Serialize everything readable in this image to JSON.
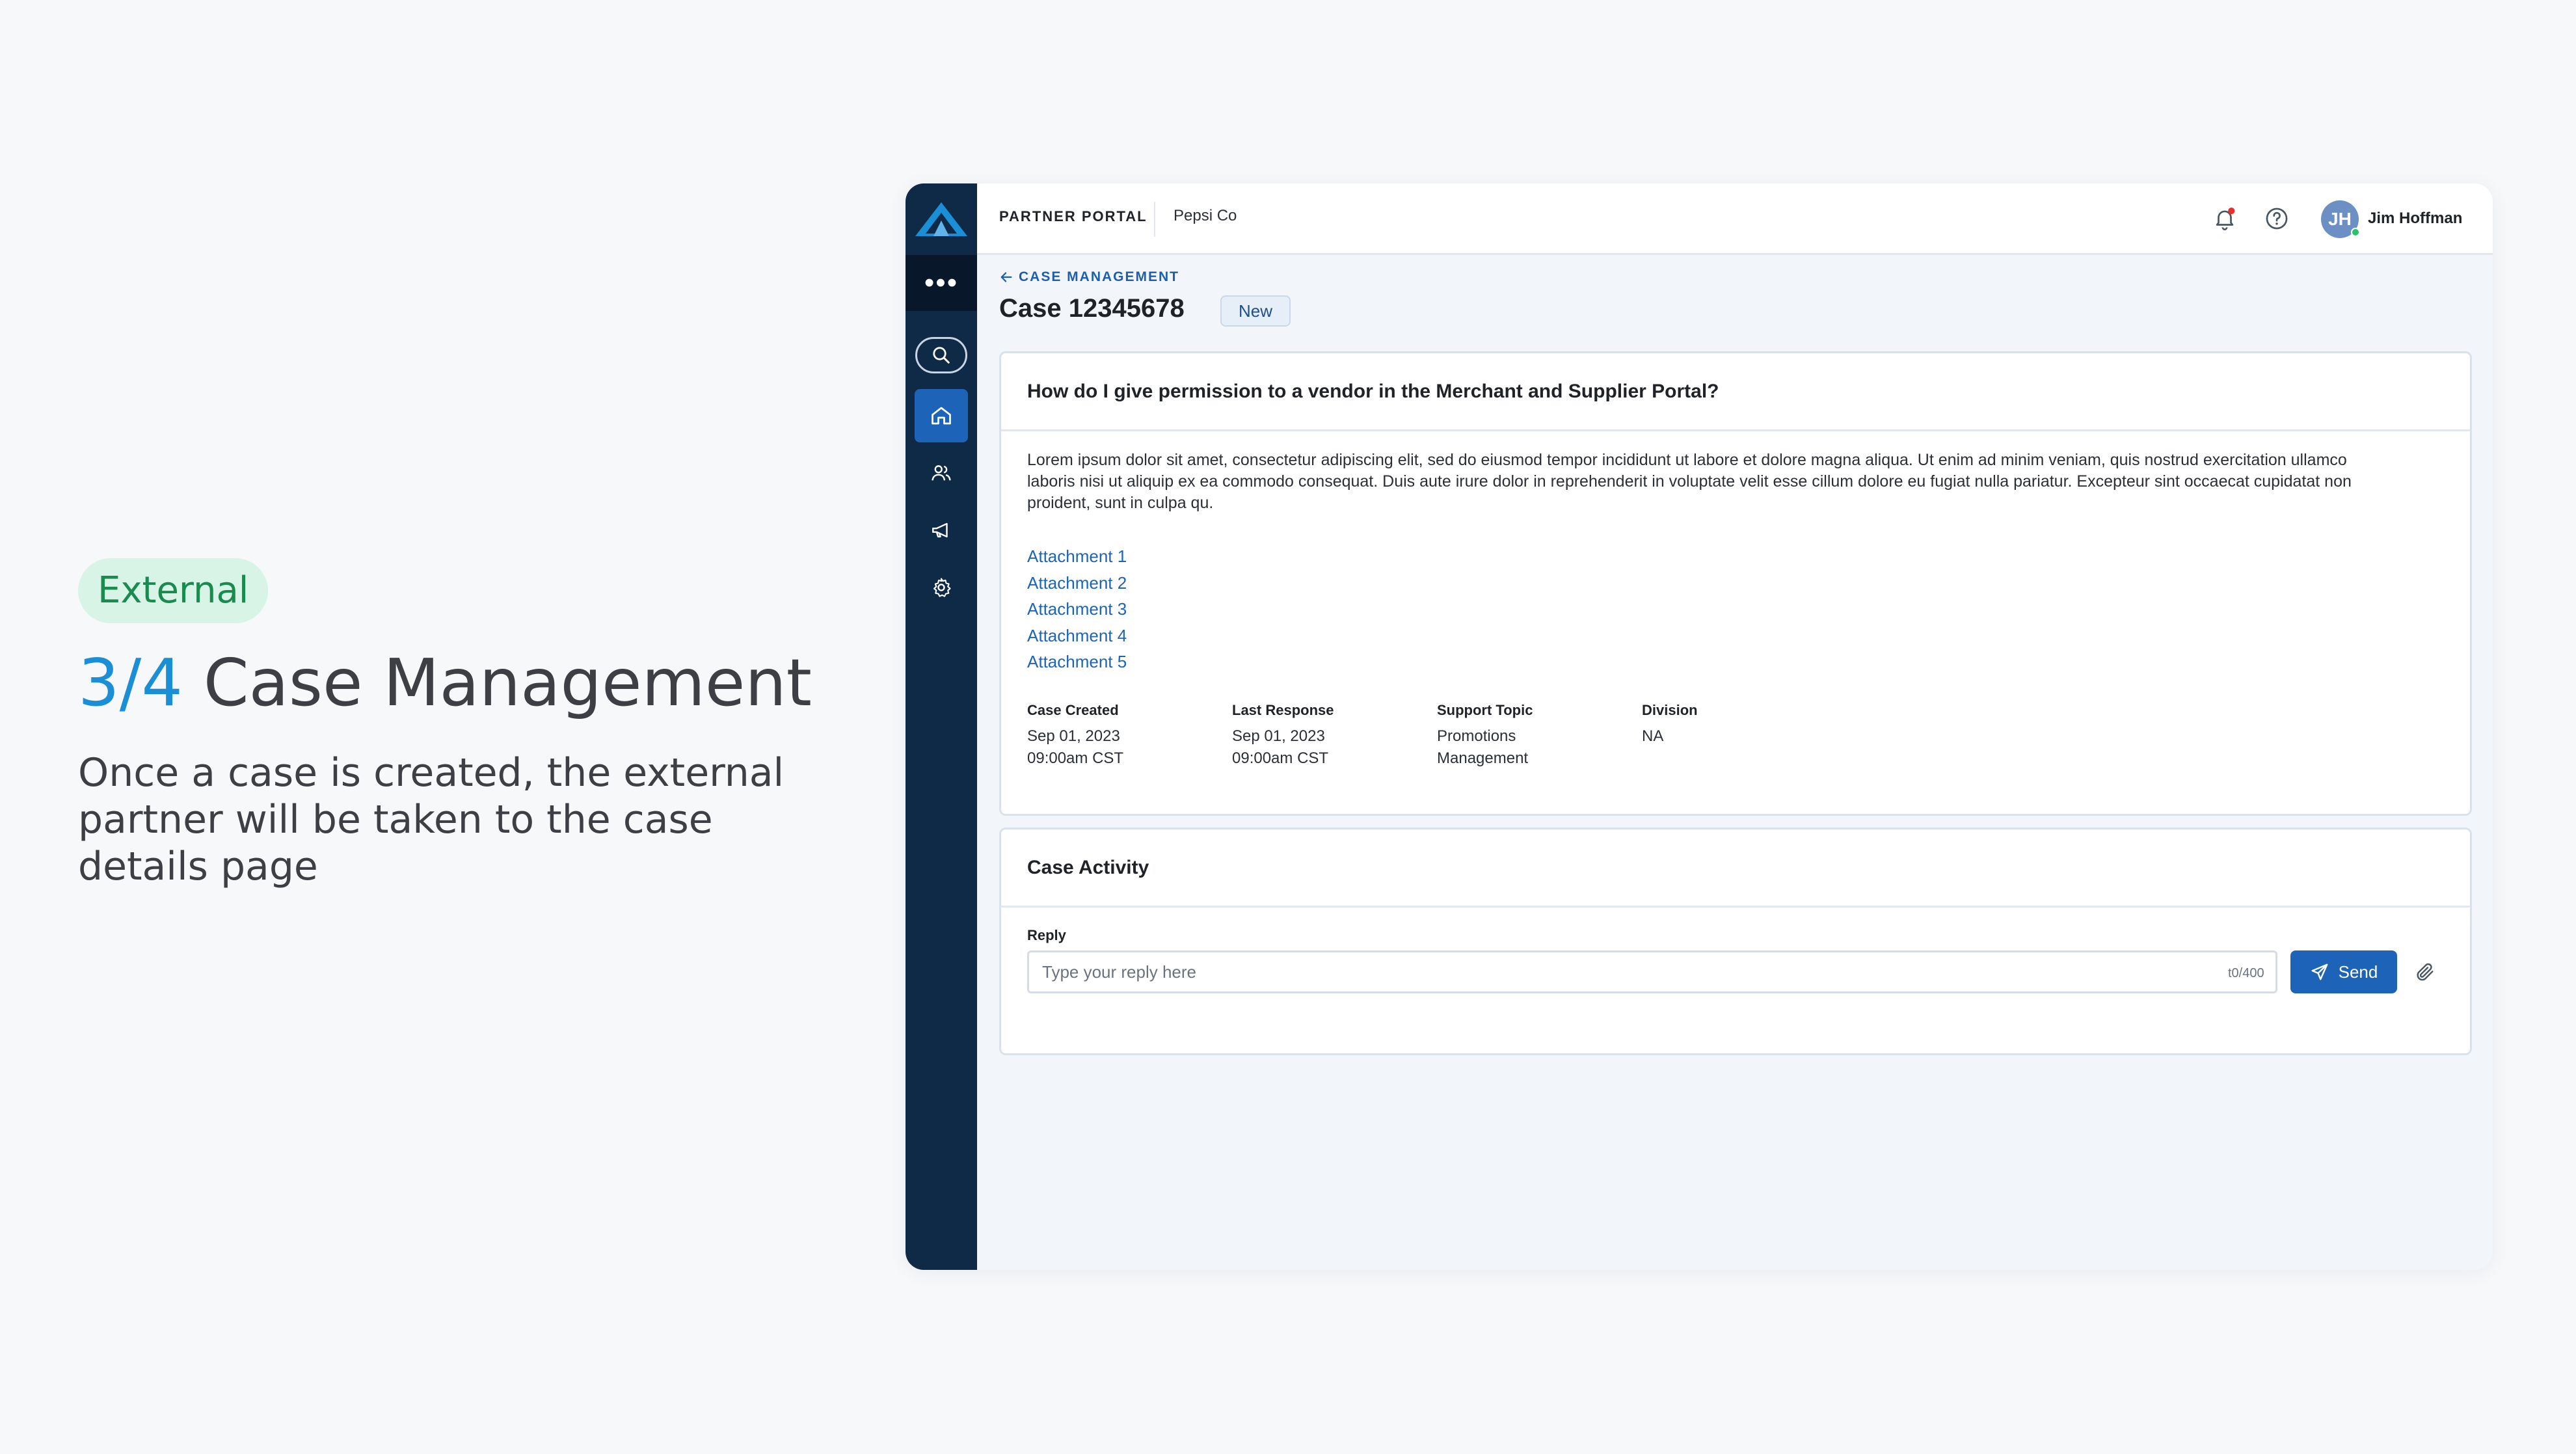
{
  "slide": {
    "badge": "External",
    "step": "3/4",
    "title": "Case Management",
    "description": "Once a case is created, the external partner will be taken to the case details page"
  },
  "header": {
    "portal_label": "PARTNER PORTAL",
    "org_name": "Pepsi Co",
    "user_initials": "JH",
    "user_name": "Jim Hoffman",
    "icons": [
      "bell-icon",
      "help-icon"
    ]
  },
  "sidebar": {
    "more_label": "•••",
    "items": [
      "search-icon",
      "home-icon",
      "users-icon",
      "megaphone-icon",
      "gear-icon"
    ],
    "active_item": "home-icon"
  },
  "case": {
    "breadcrumb": "CASE MANAGEMENT",
    "title": "Case 12345678",
    "status": "New",
    "question": "How do I give permission to a vendor in the Merchant and Supplier Portal?",
    "description": "Lorem ipsum dolor sit amet, consectetur adipiscing elit, sed do eiusmod tempor incididunt ut labore et dolore magna aliqua. Ut enim ad minim veniam, quis nostrud exercitation ullamco laboris nisi ut aliquip ex ea commodo consequat. Duis aute irure dolor in reprehenderit in voluptate velit esse cillum dolore eu fugiat nulla pariatur. Excepteur sint occaecat cupidatat non proident, sunt in culpa qu.",
    "attachments": [
      "Attachment 1",
      "Attachment 2",
      "Attachment 3",
      "Attachment 4",
      "Attachment 5"
    ],
    "meta": [
      {
        "label": "Case Created",
        "line1": "Sep 01, 2023",
        "line2": "09:00am CST"
      },
      {
        "label": "Last Response",
        "line1": "Sep 01, 2023",
        "line2": "09:00am CST"
      },
      {
        "label": "Support Topic",
        "line1": "Promotions",
        "line2": "Management"
      },
      {
        "label": "Division",
        "line1": "NA",
        "line2": ""
      }
    ]
  },
  "activity": {
    "title": "Case Activity",
    "reply_label": "Reply",
    "reply_value": "",
    "reply_placeholder": "Type your reply here",
    "counter": "t0/400",
    "send_label": "Send"
  },
  "colors": {
    "accent": "#1d64b8",
    "sidebar": "#0e2a47",
    "badge_bg": "#d7f4e6",
    "badge_text": "#1b8a4f",
    "step_color": "#1a8fd6",
    "notification_dot": "#e5322d"
  }
}
